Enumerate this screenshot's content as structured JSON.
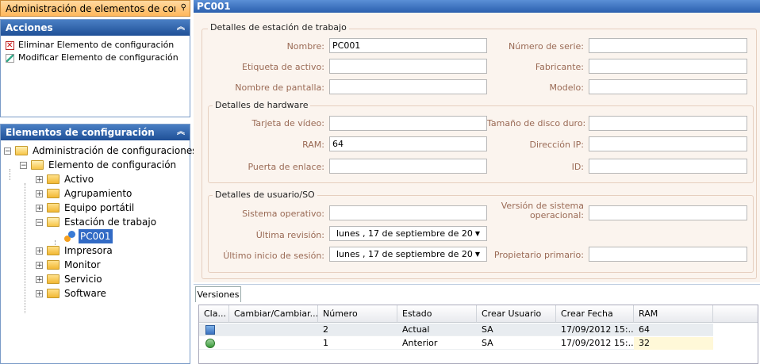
{
  "tab_title": "Administración de elementos de configu",
  "acciones": {
    "title": "Acciones",
    "items": [
      {
        "label": "Eliminar Elemento de configuración",
        "icon": "delete-icon"
      },
      {
        "label": "Modificar Elemento de configuración",
        "icon": "edit-icon"
      }
    ]
  },
  "tree": {
    "title": "Elementos de configuración",
    "root": "Administración de configuraciones",
    "child": "Elemento de configuración",
    "items": [
      "Activo",
      "Agrupamiento",
      "Equipo portátil",
      "Estación de trabajo",
      "Impresora",
      "Monitor",
      "Servicio",
      "Software"
    ],
    "selected": "PC001"
  },
  "detail": {
    "title": "PC001",
    "group_workstation": "Detalles de estación de trabajo",
    "group_hardware": "Detalles de hardware",
    "group_user": "Detalles de usuario/SO",
    "labels": {
      "nombre": "Nombre:",
      "etiqueta": "Etiqueta de activo:",
      "pantalla": "Nombre de pantalla:",
      "serie": "Número de serie:",
      "fabricante": "Fabricante:",
      "modelo": "Modelo:",
      "tarjeta": "Tarjeta de vídeo:",
      "ram": "RAM:",
      "puerta": "Puerta de enlace:",
      "disco": "Tamaño de disco duro:",
      "ip": "Dirección IP:",
      "id": "ID:",
      "so": "Sistema operativo:",
      "revision": "Última revisión:",
      "sesion": "Último inicio de sesión:",
      "version_so": "Versión de sistema operacional:",
      "propietario": "Propietario primario:"
    },
    "values": {
      "nombre": "PC001",
      "ram": "64",
      "revision": "lunes    , 17 de septiembre de 20",
      "sesion": "lunes    , 17 de septiembre de 20"
    }
  },
  "versions": {
    "tab": "Versiones",
    "columns": [
      "Cla...",
      "Cambiar/Cambiar...",
      "Número",
      "Estado",
      "Crear Usuario",
      "Crear Fecha",
      "RAM"
    ],
    "rows": [
      {
        "numero": "2",
        "estado": "Actual",
        "usuario": "SA",
        "fecha": "17/09/2012 15:...",
        "ram": "64"
      },
      {
        "numero": "1",
        "estado": "Anterior",
        "usuario": "SA",
        "fecha": "17/09/2012 15:...",
        "ram": "32"
      }
    ]
  }
}
